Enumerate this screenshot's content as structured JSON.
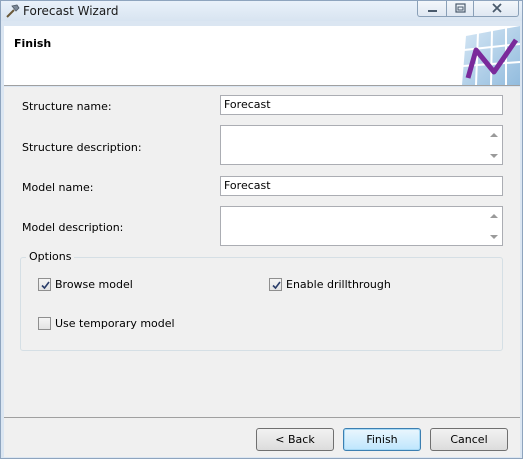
{
  "window": {
    "title": "Forecast Wizard",
    "app_icon": "hammer-icon"
  },
  "title_buttons": {
    "minimize_icon": "minimize-icon",
    "maximize_icon": "restore-icon",
    "close_icon": "close-icon"
  },
  "header": {
    "title": "Finish",
    "graphic_icon": "forecast-chart-icon",
    "accent_color": "#7a2a9b"
  },
  "fields": {
    "structure_name": {
      "label": "Structure name:",
      "value": "Forecast"
    },
    "structure_description": {
      "label": "Structure description:",
      "value": ""
    },
    "model_name": {
      "label": "Model name:",
      "value": "Forecast"
    },
    "model_description": {
      "label": "Model description:",
      "value": ""
    }
  },
  "options": {
    "title": "Options",
    "browse_model": {
      "label": "Browse model",
      "checked": true
    },
    "enable_drillthrough": {
      "label": "Enable drillthrough",
      "checked": true
    },
    "use_temporary_model": {
      "label": "Use temporary model",
      "checked": false
    }
  },
  "buttons": {
    "back": "< Back",
    "finish": "Finish",
    "cancel": "Cancel"
  }
}
